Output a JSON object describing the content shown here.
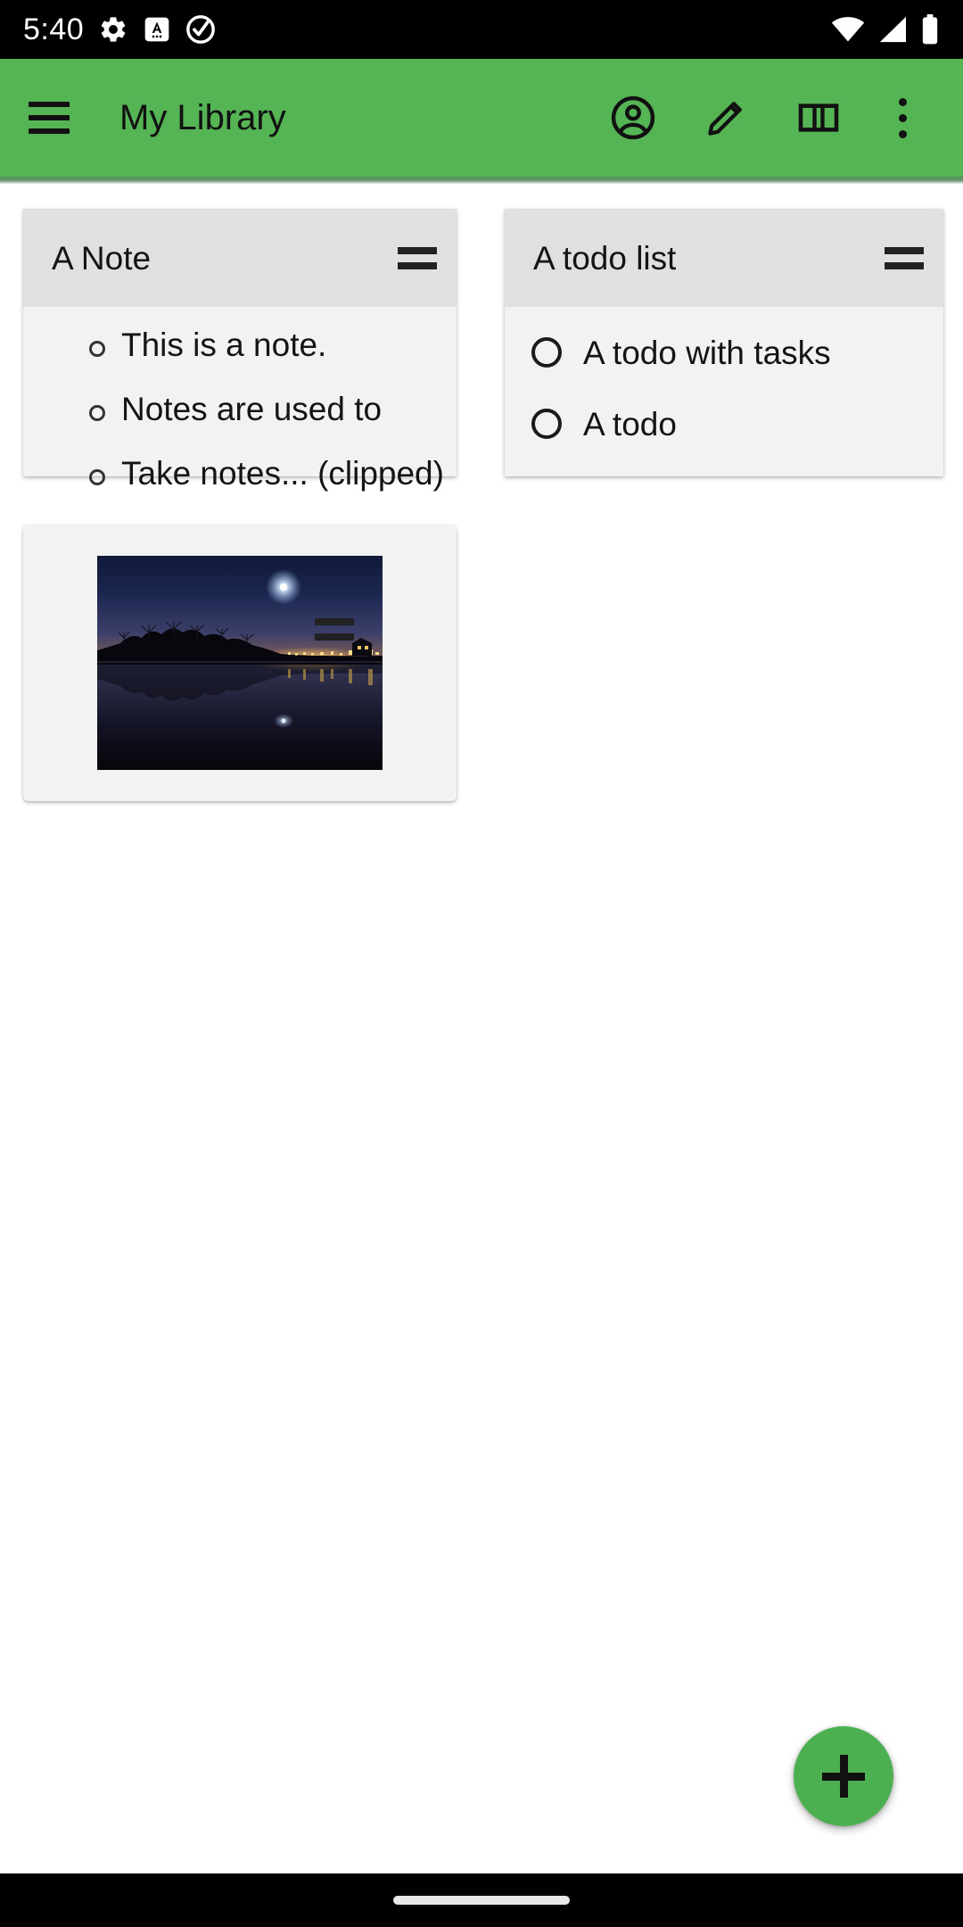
{
  "status_bar": {
    "clock": "5:40",
    "left_icons": [
      "gear-icon",
      "a-badge-icon",
      "check-circle-icon"
    ],
    "right_icons": [
      "wifi-icon",
      "cell-signal-icon",
      "battery-icon"
    ],
    "background_color": "#000000",
    "foreground_color": "#ffffff"
  },
  "app_bar": {
    "menu_icon": "hamburger-menu-icon",
    "title": "My Library",
    "background_color": "#55b555",
    "actions": [
      {
        "name": "account-circle-icon",
        "label": "Account"
      },
      {
        "name": "pencil-edit-icon",
        "label": "Edit"
      },
      {
        "name": "view-columns-icon",
        "label": "Columns"
      },
      {
        "name": "overflow-menu-icon",
        "label": "More options"
      }
    ]
  },
  "library": {
    "cards": [
      {
        "id": "note-card",
        "type": "note",
        "title": "A Note",
        "drag_handle": "drag-handle-icon",
        "items": [
          "This is a note.",
          "Notes are used to",
          "Take notes... (clipped)"
        ]
      },
      {
        "id": "todo-card",
        "type": "todo-list",
        "title": "A todo list",
        "drag_handle": "drag-handle-icon",
        "items": [
          {
            "label": "A todo with tasks",
            "checked": false
          },
          {
            "label": "A todo",
            "checked": false
          }
        ]
      },
      {
        "id": "image-card",
        "type": "image",
        "title": "",
        "drag_handle": "drag-handle-icon",
        "image_alt": "Night lake with moon, tree silhouettes and reflection"
      }
    ]
  },
  "fab": {
    "icon": "plus-icon",
    "label": "Add",
    "color": "#4caf50"
  },
  "nav_bar": {
    "home_pill": "home-gesture-pill",
    "background_color": "#000000"
  }
}
